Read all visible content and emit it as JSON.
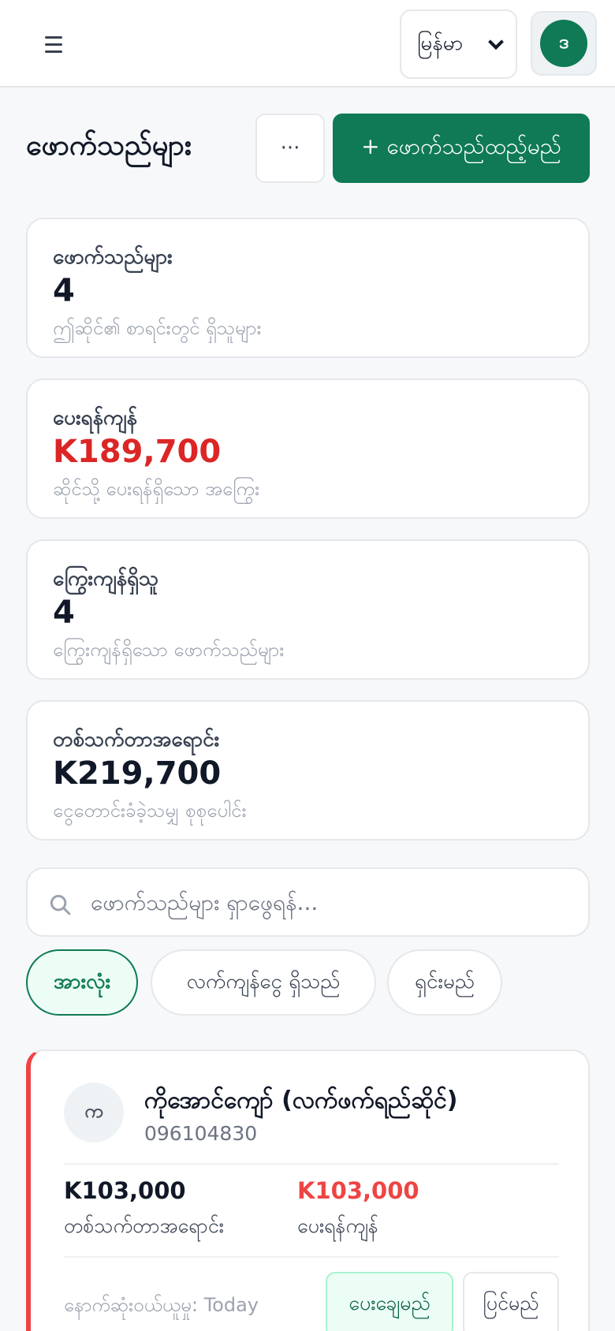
{
  "header": {
    "language_select": {
      "value": "မြန်မာ"
    },
    "user_avatar_initial": "ဒ"
  },
  "page": {
    "title": "ဖောက်သည်များ",
    "more_label": "···",
    "add_button_label": "+ ဖောက်သည်ထည့်မည်"
  },
  "stats": [
    {
      "label": "ဖောက်သည်များ",
      "value": "4",
      "sub": "ဤဆိုင်၏ စာရင်းတွင် ရှိသူများ"
    },
    {
      "label": "ပေးရန်ကျန်",
      "value": "K189,700",
      "sub": "ဆိုင်သို့ ပေးရန်ရှိသော အကြွေး",
      "value_color": "#dc2626"
    },
    {
      "label": "ကြွေးကျန်ရှိသူ",
      "value": "4",
      "sub": "ကြွေးကျန်ရှိသော ဖောက်သည်များ"
    },
    {
      "label": "တစ်သက်တာအရောင်း",
      "value": "K219,700",
      "sub": "ငွေတောင်းခံခဲ့သမျှ စုစုပေါင်း"
    }
  ],
  "search": {
    "placeholder": "ဖောက်သည်များ ရှာဖွေရန်..."
  },
  "filters": [
    {
      "label": "အားလုံး",
      "active": true
    },
    {
      "label": "လက်ကျန်ငွေ ရှိသည်",
      "active": false
    },
    {
      "label": "ရှင်းမည်",
      "active": false
    }
  ],
  "customers": [
    {
      "initial": "က",
      "name": "ကိုအောင်ကျော် (လက်ဖက်ရည်ဆိုင်)",
      "phone": "096104830",
      "lifetime_value": "K103,000",
      "lifetime_label": "တစ်သက်တာအရောင်း",
      "due_value": "K103,000",
      "due_label": "ပေးရန်ကျန်",
      "last_purchase": "နောက်ဆုံးဝယ်ယူမှု: Today",
      "pay_button": "ပေးချေမည်",
      "edit_button": "ပြင်မည်"
    }
  ]
}
